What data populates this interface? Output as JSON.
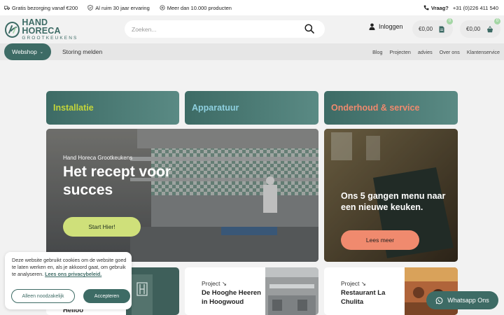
{
  "topbar": {
    "usps": [
      {
        "icon": "truck-icon",
        "text": "Gratis bezorging vanaf €200"
      },
      {
        "icon": "shield-check-icon",
        "text": "Al ruim 30 jaar ervaring"
      },
      {
        "icon": "box-icon",
        "text": "Meer dan 10.000 producten"
      }
    ],
    "phone": {
      "icon": "phone-icon",
      "question": "Vraag?",
      "number": "+31 (0)226 411 540"
    }
  },
  "header": {
    "logo_line1": "HAND HORECA",
    "logo_line2": "GROOTKEUKENS",
    "search_placeholder": "Zoeken...",
    "login_label": "Inloggen",
    "compare": {
      "amount": "€0,00",
      "count": "0",
      "icon": "document-icon"
    },
    "cart": {
      "amount": "€0,00",
      "count": "0",
      "icon": "shopping-basket-icon"
    }
  },
  "nav": {
    "webshop_label": "Webshop",
    "storing_label": "Storing melden",
    "links": [
      "Blog",
      "Projecten",
      "advies",
      "Over ons",
      "Klantenservice"
    ]
  },
  "categories": [
    {
      "label": "Installatie",
      "color": "#c4d63a"
    },
    {
      "label": "Apparatuur",
      "color": "#8ed0e0"
    },
    {
      "label": "Onderhoud & service",
      "color": "#f08a6e"
    }
  ],
  "hero": {
    "kicker": "Hand Horeca Grootkeukens",
    "title": "Het recept voor succes",
    "button": "Start Hier!"
  },
  "menu_promo": {
    "title": "Ons 5 gangen menu naar een nieuwe keuken.",
    "button": "Lees meer"
  },
  "projects": [
    {
      "label": "",
      "title": "Helloo"
    },
    {
      "label": "Project",
      "title": "De Hooghe Heeren in Hoogwoud"
    },
    {
      "label": "Project",
      "title": "Restaurant La Chulita"
    }
  ],
  "cookie": {
    "text": "Deze website gebruikt cookies om de website goed te laten werken en, als je akkoord gaat, om gebruik te analyseren.",
    "link": "Lees ons privacybeleid.",
    "decline": "Alleen noodzakelijk",
    "accept": "Accepteren"
  },
  "whatsapp": {
    "label": "Whatsapp Ons"
  },
  "colors": {
    "brand": "#3d6b65",
    "accent_green": "#cfe07a",
    "accent_coral": "#f08a6e",
    "badge": "#a4d6a5"
  }
}
